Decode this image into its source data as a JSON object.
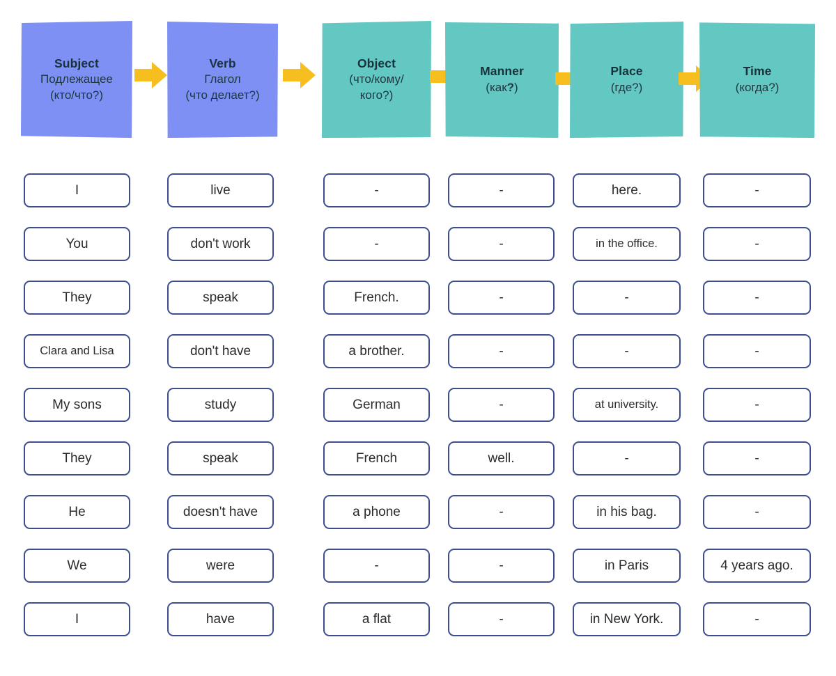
{
  "colors": {
    "subject_card": "#7f90f5",
    "verb_card": "#7f90f5",
    "object_card": "#63c8c2",
    "manner_card": "#63c8c2",
    "place_card": "#63c8c2",
    "time_card": "#63c8c2",
    "arrow": "#f6bf1f",
    "cell_border": "#3e4d8f",
    "page_background": "#ffffff",
    "card_text": "#17323c"
  },
  "header": {
    "cards": [
      {
        "title": "Subject",
        "subtitle": "Подлежащее\n(кто/что?)",
        "color": "#7f90f5"
      },
      {
        "title": "Verb",
        "subtitle": "Глагол\n(что делает?)",
        "color": "#7f90f5"
      },
      {
        "title": "Object",
        "subtitle": "(что/кому/\nкого?)",
        "color": "#63c8c2"
      },
      {
        "title": "Manner",
        "subtitle": "(как?)",
        "color": "#63c8c2"
      },
      {
        "title": "Place",
        "subtitle": "(где?)",
        "color": "#63c8c2"
      },
      {
        "title": "Time",
        "subtitle": "(когда?)",
        "color": "#63c8c2"
      }
    ],
    "arrows": [
      "arrow-right-icon",
      "arrow-right-icon",
      "arrow-right-icon",
      "arrow-right-icon",
      "arrow-right-icon"
    ]
  },
  "table": {
    "columns": [
      "Subject",
      "Verb",
      "Object",
      "Manner",
      "Place",
      "Time"
    ],
    "empty_marker": "-",
    "rows": [
      {
        "subject": "I",
        "verb": "live",
        "object": "-",
        "manner": "-",
        "place": "here.",
        "time": "-"
      },
      {
        "subject": "You",
        "verb": "don't work",
        "object": "-",
        "manner": "-",
        "place": "in the office.",
        "time": "-"
      },
      {
        "subject": "They",
        "verb": "speak",
        "object": "French.",
        "manner": "-",
        "place": "-",
        "time": "-"
      },
      {
        "subject": "Clara and Lisa",
        "verb": "don't have",
        "object": "a brother.",
        "manner": "-",
        "place": "-",
        "time": "-"
      },
      {
        "subject": "My sons",
        "verb": "study",
        "object": "German",
        "manner": "-",
        "place": "at university.",
        "time": "-"
      },
      {
        "subject": "They",
        "verb": "speak",
        "object": "French",
        "manner": "well.",
        "place": "-",
        "time": "-"
      },
      {
        "subject": "He",
        "verb": "doesn't have",
        "object": "a phone",
        "manner": "-",
        "place": "in his bag.",
        "time": "-"
      },
      {
        "subject": "We",
        "verb": "were",
        "object": "-",
        "manner": "-",
        "place": "in Paris",
        "time": "4 years ago."
      },
      {
        "subject": "I",
        "verb": "have",
        "object": "a flat",
        "manner": "-",
        "place": "in New York.",
        "time": "-"
      }
    ]
  }
}
